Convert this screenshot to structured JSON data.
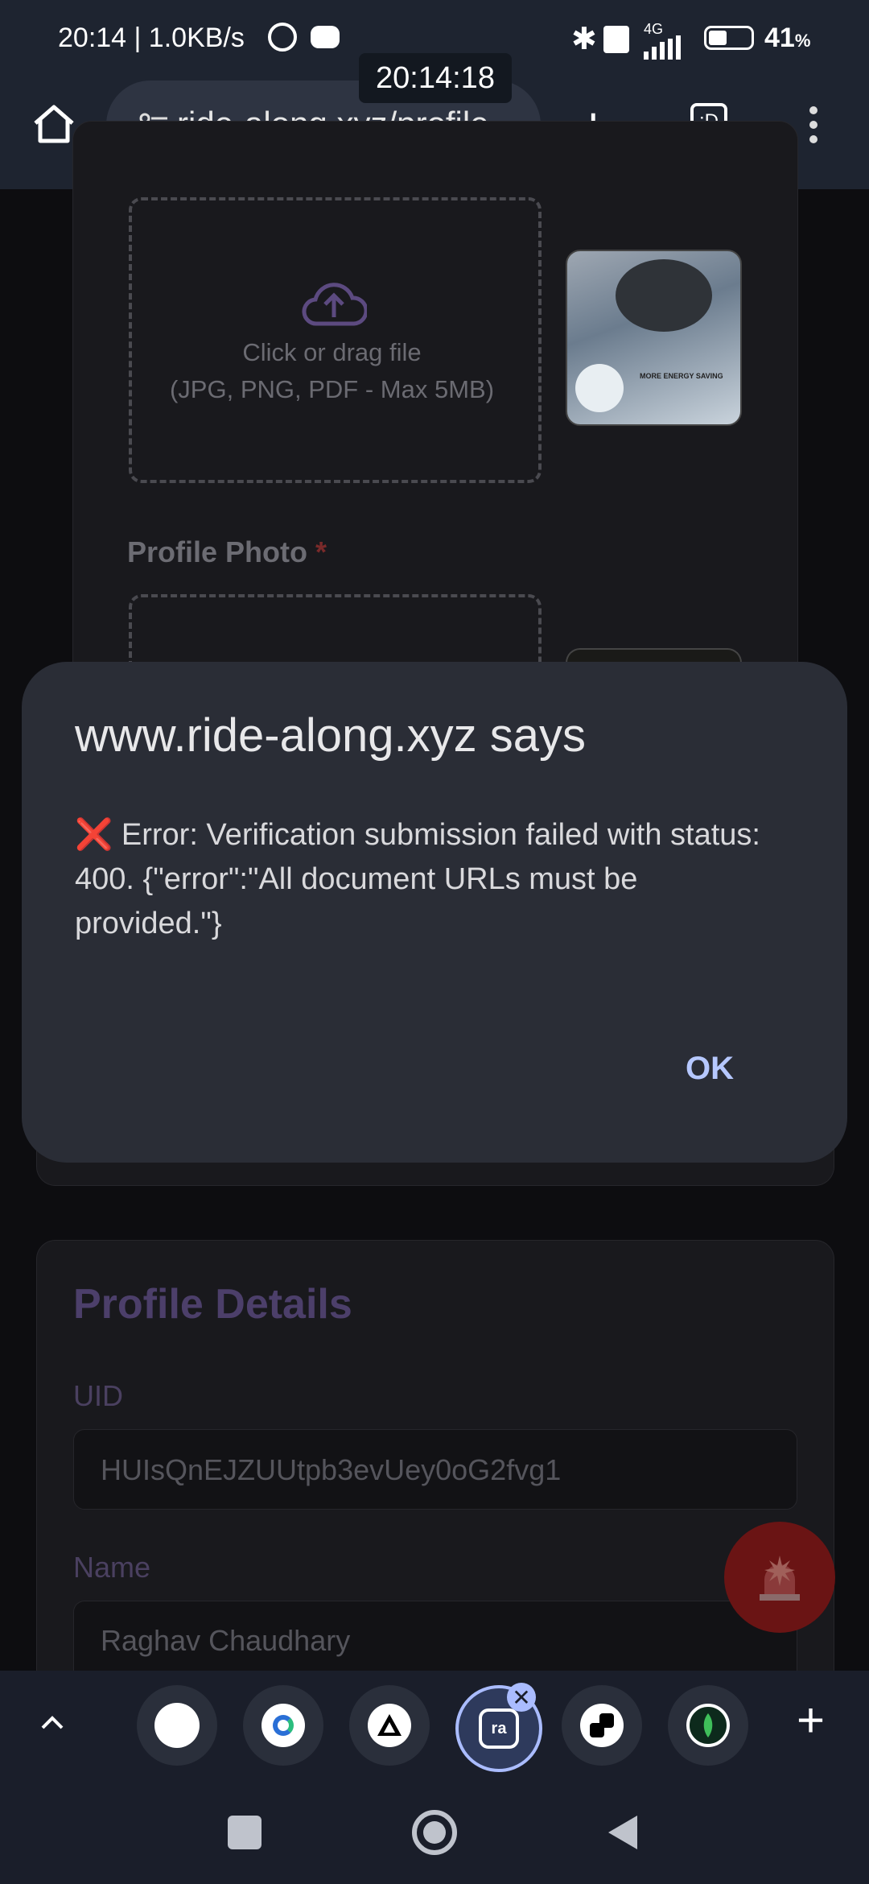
{
  "status_bar": {
    "time_speed": "20:14 | 1.0KB/s",
    "battery": "41",
    "battery_unit": "%",
    "network": "4G",
    "overlay_time": "20:14:18"
  },
  "browser": {
    "url": "ride-along.xyz/profile",
    "tab_label": ":D"
  },
  "upload": {
    "drop_text": "Click or drag file",
    "drop_hint": "(JPG, PNG, PDF - Max 5MB)",
    "thumb_caption": "MORE ENERGY SAVING",
    "profile_photo_label": "Profile Photo",
    "required_mark": "*"
  },
  "profile_details": {
    "title": "Profile Details",
    "uid_label": "UID",
    "uid_value": "HUIsQnEJZUUtpb3evUey0oG2fvg1",
    "name_label": "Name",
    "name_value": "Raghav Chaudhary"
  },
  "dialog": {
    "title": "www.ride-along.xyz says",
    "message": "❌ Error: Verification submission failed with status: 400. {\"error\":\"All document URLs must be provided.\"}",
    "ok_label": "OK"
  },
  "tabbar": {
    "icons": [
      "white-circle",
      "chrome-like-icon",
      "triangle-logo",
      "ride-along-tab",
      "link-icon",
      "mongodb-leaf"
    ]
  }
}
